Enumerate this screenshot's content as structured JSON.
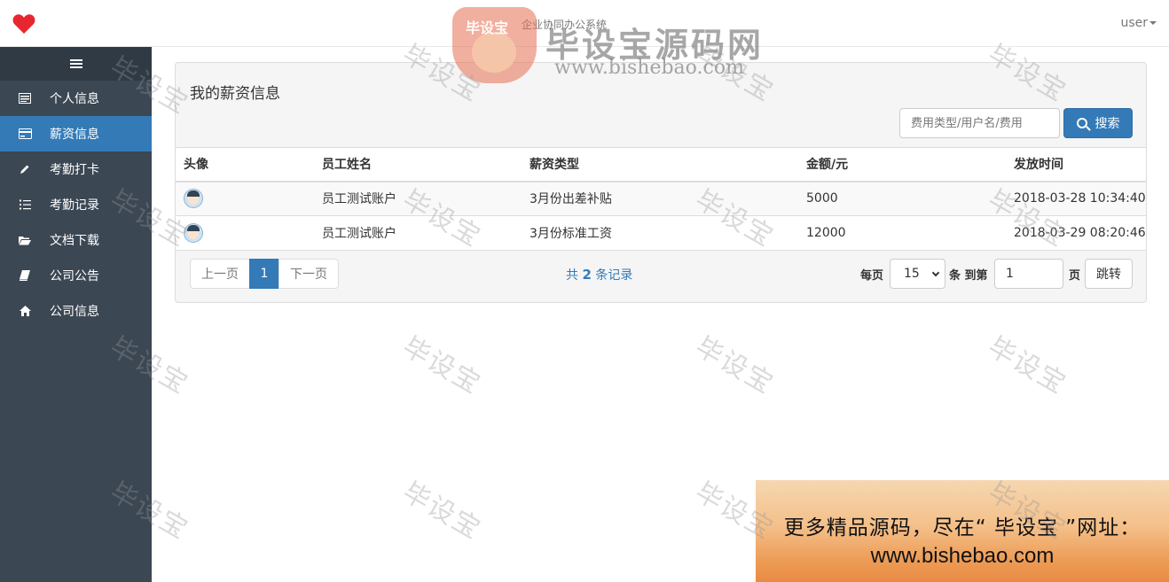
{
  "header": {
    "app_title": "企业协同办公系统",
    "user_label": "user",
    "logo_icon": "heart-icon",
    "logo_color": "#e8262f"
  },
  "sidebar": {
    "toggle_icon": "hamburger-icon",
    "items": [
      {
        "label": "个人信息",
        "icon": "card-icon",
        "active": false
      },
      {
        "label": "薪资信息",
        "icon": "credit-card-icon",
        "active": true
      },
      {
        "label": "考勤打卡",
        "icon": "pencil-icon",
        "active": false
      },
      {
        "label": "考勤记录",
        "icon": "list-icon",
        "active": false
      },
      {
        "label": "文档下载",
        "icon": "folder-open-icon",
        "active": false
      },
      {
        "label": "公司公告",
        "icon": "book-icon",
        "active": false
      },
      {
        "label": "公司信息",
        "icon": "home-icon",
        "active": false
      }
    ]
  },
  "panel": {
    "title": "我的薪资信息",
    "search_placeholder": "费用类型/用户名/费用",
    "search_button": "搜索"
  },
  "table": {
    "columns": [
      "头像",
      "员工姓名",
      "薪资类型",
      "金额/元",
      "发放时间"
    ],
    "rows": [
      {
        "name": "员工测试账户",
        "type": "3月份出差补贴",
        "amount": "5000",
        "time": "2018-03-28 10:34:40"
      },
      {
        "name": "员工测试账户",
        "type": "3月份标准工资",
        "amount": "12000",
        "time": "2018-03-29 08:20:46"
      }
    ]
  },
  "pagination": {
    "prev": "上一页",
    "current": "1",
    "next": "下一页",
    "records_prefix": "共",
    "records_count": "2",
    "records_suffix": "条记录",
    "per_page_label": "每页",
    "page_size": "15",
    "goto_label": "条 到第",
    "goto_value": "1",
    "page_suffix": "页",
    "jump_button": "跳转"
  },
  "watermark": {
    "text": "毕设宝",
    "logo_badge": "毕设宝",
    "logo_title": "毕设宝源码网",
    "logo_url": "www.bishebao.com"
  },
  "promo": {
    "line1": "更多精品源码，尽在“ 毕设宝 ”网址：",
    "line2": "www.bishebao.com"
  },
  "colors": {
    "sidebar_bg": "#3b4753",
    "accent": "#337ab7"
  }
}
